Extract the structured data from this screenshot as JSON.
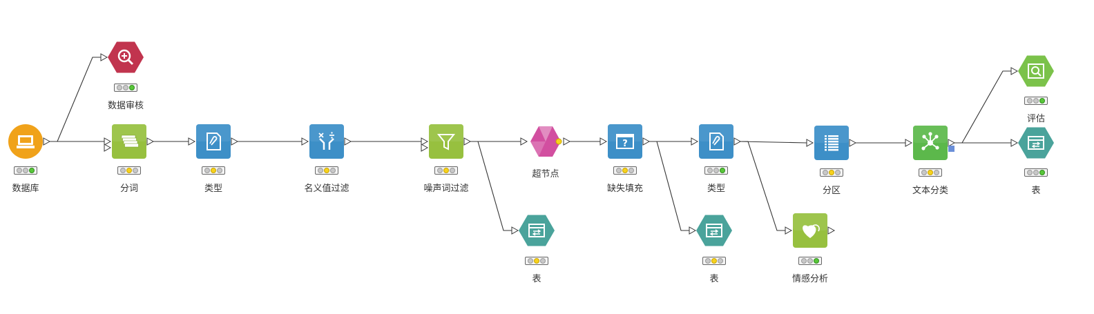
{
  "nodes": [
    {
      "id": "db",
      "label": "数据库",
      "icon": "database-icon",
      "shape": "circle",
      "color": "#f0a21a",
      "status": "green"
    },
    {
      "id": "audit",
      "label": "数据审核",
      "icon": "zoom-in-icon",
      "shape": "hexagon",
      "color": "#c1344e",
      "status": "green"
    },
    {
      "id": "seg",
      "label": "分词",
      "icon": "document-stack-icon",
      "shape": "square",
      "color": "#97c03f",
      "status": "yellow"
    },
    {
      "id": "type1",
      "label": "类型",
      "icon": "attachment-document-icon",
      "shape": "square",
      "color": "#3d8fc7",
      "status": "yellow"
    },
    {
      "id": "nominal",
      "label": "名义值过滤",
      "icon": "split-operators-icon",
      "shape": "square",
      "color": "#3d8fc7",
      "status": "yellow"
    },
    {
      "id": "noise",
      "label": "噪声词过滤",
      "icon": "filter-funnel-icon",
      "shape": "square",
      "color": "#97c03f",
      "status": "yellow"
    },
    {
      "id": "table1",
      "label": "表",
      "icon": "table-icon",
      "shape": "hexagon",
      "color": "#4aa39b",
      "status": "yellow"
    },
    {
      "id": "super",
      "label": "超节点",
      "icon": "supernode-diamond-icon",
      "shape": "diamond",
      "color": "#d24fa0",
      "status": "none"
    },
    {
      "id": "fill",
      "label": "缺失填充",
      "icon": "question-window-icon",
      "shape": "square",
      "color": "#3d8fc7",
      "status": "yellow"
    },
    {
      "id": "type2",
      "label": "类型",
      "icon": "attachment-document-icon",
      "shape": "square",
      "color": "#3d8fc7",
      "status": "green"
    },
    {
      "id": "table2",
      "label": "表",
      "icon": "table-icon",
      "shape": "hexagon",
      "color": "#4aa39b",
      "status": "yellow"
    },
    {
      "id": "partition",
      "label": "分区",
      "icon": "list-lines-icon",
      "shape": "square",
      "color": "#3d8fc7",
      "status": "yellow"
    },
    {
      "id": "sentiment",
      "label": "情感分析",
      "icon": "hearts-icon",
      "shape": "square",
      "color": "#97c03f",
      "status": "green"
    },
    {
      "id": "textcls",
      "label": "文本分类",
      "icon": "network-nodes-icon",
      "shape": "square",
      "color": "#5cb84b",
      "status": "yellow"
    },
    {
      "id": "eval",
      "label": "评估",
      "icon": "magnifier-window-icon",
      "shape": "hexagon",
      "color": "#7bc24a",
      "status": "green"
    },
    {
      "id": "table3",
      "label": "表",
      "icon": "table-icon",
      "shape": "hexagon",
      "color": "#4aa39b",
      "status": "green"
    }
  ],
  "edges": [
    {
      "from": "db",
      "to": "audit"
    },
    {
      "from": "db",
      "to": "seg"
    },
    {
      "from": "seg",
      "to": "type1"
    },
    {
      "from": "type1",
      "to": "nominal"
    },
    {
      "from": "nominal",
      "to": "noise"
    },
    {
      "from": "noise",
      "to": "super"
    },
    {
      "from": "noise",
      "to": "table1"
    },
    {
      "from": "super",
      "to": "fill"
    },
    {
      "from": "fill",
      "to": "type2"
    },
    {
      "from": "fill",
      "to": "table2"
    },
    {
      "from": "type2",
      "to": "partition"
    },
    {
      "from": "type2",
      "to": "sentiment"
    },
    {
      "from": "partition",
      "to": "textcls"
    },
    {
      "from": "textcls",
      "to": "eval"
    },
    {
      "from": "textcls",
      "to": "table3"
    }
  ]
}
